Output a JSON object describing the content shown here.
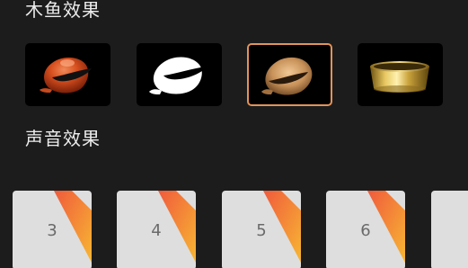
{
  "sections": {
    "fish_effect_title": "木鱼效果",
    "sound_effect_title": "声音效果"
  },
  "effects": [
    {
      "name": "red-woodfish",
      "selected": false
    },
    {
      "name": "white-woodfish",
      "selected": false
    },
    {
      "name": "wood-woodfish",
      "selected": true
    },
    {
      "name": "gold-bowl",
      "selected": false
    }
  ],
  "sounds": [
    {
      "label": "3"
    },
    {
      "label": "4"
    },
    {
      "label": "5"
    },
    {
      "label": "6"
    },
    {
      "label": ""
    }
  ],
  "colors": {
    "background": "#1c1c1c",
    "selected_border": "#e2935a",
    "card": "#dedede",
    "ribbon_start": "#f05a3c",
    "ribbon_end": "#f7b733"
  }
}
